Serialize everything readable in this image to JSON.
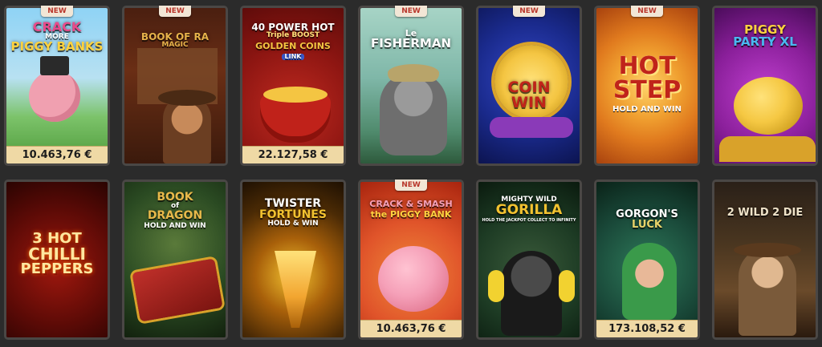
{
  "badges": {
    "new": "NEW"
  },
  "rows": [
    [
      {
        "title": "CRACK MORE PIGGY BANKS",
        "title_lines": [
          "CRACK",
          "MORE",
          "PIGGY BANKS"
        ],
        "is_new": true,
        "jackpot": "10.463,76 €",
        "colors": {
          "bg": "#7ec8f0",
          "accent": "#e84b8a"
        }
      },
      {
        "title": "BOOK OF RA MAGIC",
        "title_lines": [
          "BOOK OF RA",
          "MAGIC"
        ],
        "is_new": true,
        "jackpot": "",
        "colors": {
          "bg": "#3b1d12",
          "accent": "#e6b24a"
        }
      },
      {
        "title": "40 POWER HOT Triple BOOST GOLDEN COINS LINK",
        "title_lines": [
          "40 POWER HOT",
          "Triple BOOST",
          "GOLDEN COINS",
          "LINK"
        ],
        "is_new": false,
        "jackpot": "22.127,58 €",
        "colors": {
          "bg": "#8e1612",
          "accent": "#f4c542"
        }
      },
      {
        "title": "Le FISHERMAN",
        "title_lines": [
          "Le",
          "FISHERMAN"
        ],
        "is_new": true,
        "jackpot": "",
        "colors": {
          "bg": "#7fb7a8",
          "accent": "#ffffff"
        }
      },
      {
        "title": "COIN WIN",
        "title_lines": [
          "COIN",
          "WIN"
        ],
        "is_new": true,
        "jackpot": "",
        "colors": {
          "bg": "#1a2a8c",
          "accent": "#f4c542"
        }
      },
      {
        "title": "HOT STEP HOLD AND WIN",
        "title_lines": [
          "HOT",
          "STEP",
          "HOLD AND WIN"
        ],
        "is_new": true,
        "jackpot": "",
        "colors": {
          "bg": "#e07a1e",
          "accent": "#c0241a"
        }
      },
      {
        "title": "PIGGY PARTY XL",
        "title_lines": [
          "PIGGY",
          "PARTY XL"
        ],
        "is_new": false,
        "jackpot": "",
        "colors": {
          "bg": "#8a1f9a",
          "accent": "#f5c843"
        }
      }
    ],
    [
      {
        "title": "3 HOT CHILLI PEPPERS",
        "title_lines": [
          "3 HOT",
          "CHILLI",
          "PEPPERS"
        ],
        "is_new": false,
        "jackpot": "",
        "colors": {
          "bg": "#5a0a06",
          "accent": "#f2a530"
        }
      },
      {
        "title": "BOOK of DRAGON HOLD AND WIN",
        "title_lines": [
          "BOOK",
          "of",
          "DRAGON",
          "HOLD AND WIN"
        ],
        "is_new": false,
        "jackpot": "",
        "colors": {
          "bg": "#1f3a1c",
          "accent": "#e8b94a"
        }
      },
      {
        "title": "TWISTER FORTUNES HOLD & WIN",
        "title_lines": [
          "TWISTER",
          "FORTUNES",
          "HOLD & WIN"
        ],
        "is_new": false,
        "jackpot": "",
        "colors": {
          "bg": "#4a2a05",
          "accent": "#f2c230"
        }
      },
      {
        "title": "CRACK & SMASH the PIGGY BANK",
        "title_lines": [
          "CRACK & SMASH",
          "the PIGGY BANK"
        ],
        "is_new": true,
        "jackpot": "10.463,76 €",
        "colors": {
          "bg": "#e0542a",
          "accent": "#f5a0b8"
        }
      },
      {
        "title": "MIGHTY WILD GORILLA",
        "title_lines": [
          "MIGHTY WILD",
          "GORILLA",
          "HOLD THE JACKPOT COLLECT TO INFINITY"
        ],
        "is_new": false,
        "jackpot": "",
        "colors": {
          "bg": "#1d3b24",
          "accent": "#f2c230"
        }
      },
      {
        "title": "GORGON'S LUCK",
        "title_lines": [
          "GORGON'S",
          "LUCK"
        ],
        "is_new": false,
        "jackpot": "173.108,52 €",
        "colors": {
          "bg": "#1a4a3a",
          "accent": "#e8d36a"
        }
      },
      {
        "title": "2 WILD 2 DIE",
        "title_lines": [
          "2 WILD 2 DIE"
        ],
        "is_new": false,
        "jackpot": "",
        "colors": {
          "bg": "#4a3620",
          "accent": "#efe3c9"
        }
      }
    ]
  ]
}
